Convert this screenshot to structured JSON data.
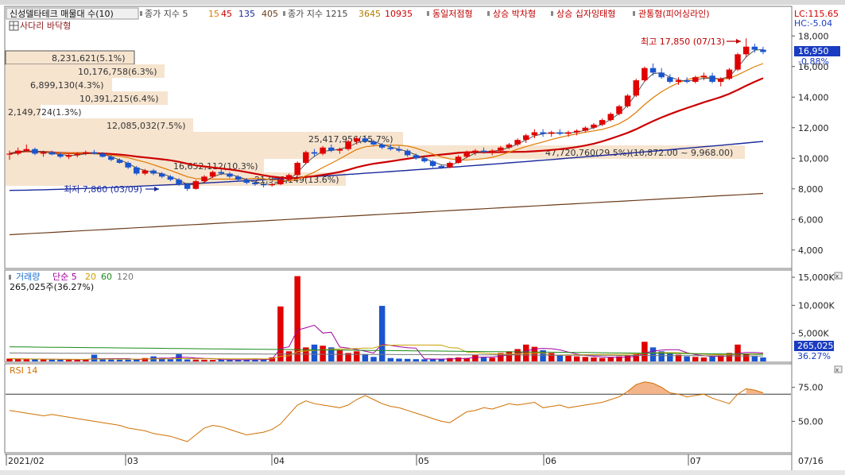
{
  "header": {
    "title_button": "신성델타테크 매물대 수(10)",
    "legend": [
      {
        "label": "종가 지수 5",
        "color": "#444444"
      },
      {
        "label": "15",
        "color": "#e07a00"
      },
      {
        "label": "45",
        "color": "#cc0000"
      },
      {
        "label": "135",
        "color": "#1a2a9c"
      },
      {
        "label": "405",
        "color": "#6b3c1a"
      },
      {
        "label": "종가 지수 1215",
        "color": "#444444"
      },
      {
        "label": "3645",
        "color": "#b07a00"
      },
      {
        "label": "10935",
        "color": "#cc0000"
      }
    ],
    "patterns": [
      {
        "label": "동일저점형",
        "color": "#c00000"
      },
      {
        "label": "상승 박차형",
        "color": "#c00000"
      },
      {
        "label": "상승 십자잉태형",
        "color": "#c00000"
      },
      {
        "label": "관통형(피어싱라인)",
        "color": "#c00000"
      }
    ],
    "pattern2": "사다리 바닥형",
    "lc": "LC:115.65",
    "hc": "HC:-5.04"
  },
  "price_panel": {
    "y_ticks": [
      "18,000",
      "16,000",
      "14,000",
      "12,000",
      "10,000",
      "8,000",
      "6,000",
      "4,000"
    ],
    "current_price": "16,950",
    "current_change": "-0.88%",
    "high_label": "최고 17,850 (07/13)",
    "low_label": "최저 7,860 (03/09)",
    "volume_profile": [
      {
        "label": "8,231,621(5.1%)"
      },
      {
        "label": "10,176,758(6.3%)"
      },
      {
        "label": "6,899,130(4.3%)"
      },
      {
        "label": "10,391,215(6.4%)"
      },
      {
        "label": "2,149,724(1.3%)"
      },
      {
        "label": "12,085,032(7.5%)"
      },
      {
        "label": "25,417,956(15.7%)"
      },
      {
        "label": "47,720,760(29.5%)(10,872.00 ~ 9,968.00)"
      },
      {
        "label": "16,652,112(10.3%)"
      },
      {
        "label": "21,958,149(13.6%)"
      }
    ]
  },
  "volume_panel": {
    "legend": [
      {
        "label": "거래량",
        "color": "#1a6fd0"
      },
      {
        "label": "단순 5",
        "color": "#a000a0"
      },
      {
        "label": "20",
        "color": "#c8a000"
      },
      {
        "label": "60",
        "color": "#1a8a1a"
      },
      {
        "label": "120",
        "color": "#777777"
      }
    ],
    "info": "265,025주(36.27%)",
    "y_ticks": [
      "15,000K",
      "10,000K",
      "5,000K"
    ],
    "current_value": "265,025",
    "current_pct": "36.27%"
  },
  "rsi_panel": {
    "label": "RSI 14",
    "y_ticks": [
      "75.00",
      "50.00"
    ]
  },
  "x_axis": {
    "labels": [
      "2021/02",
      "03",
      "04",
      "05",
      "06",
      "07"
    ],
    "end_label": "07/16"
  },
  "chart_data": {
    "type": "candlestick",
    "price_ylim": [
      3000,
      19000
    ],
    "candles": [
      [
        10250,
        10500,
        9900,
        10300
      ],
      [
        10300,
        10700,
        10200,
        10500
      ],
      [
        10500,
        10900,
        10400,
        10600
      ],
      [
        10600,
        10700,
        10200,
        10300
      ],
      [
        10300,
        10500,
        10100,
        10400
      ],
      [
        10400,
        10500,
        10200,
        10250
      ],
      [
        10250,
        10400,
        10000,
        10100
      ],
      [
        10100,
        10300,
        9950,
        10200
      ],
      [
        10200,
        10400,
        10050,
        10300
      ],
      [
        10300,
        10500,
        10200,
        10400
      ],
      [
        10400,
        10550,
        10250,
        10300
      ],
      [
        10300,
        10400,
        10050,
        10100
      ],
      [
        10100,
        10200,
        9800,
        9900
      ],
      [
        9900,
        10000,
        9650,
        9700
      ],
      [
        9700,
        9800,
        9300,
        9400
      ],
      [
        9400,
        9500,
        8900,
        9000
      ],
      [
        9000,
        9300,
        8900,
        9200
      ],
      [
        9200,
        9300,
        8900,
        9000
      ],
      [
        9000,
        9100,
        8700,
        8800
      ],
      [
        8800,
        8900,
        8500,
        8600
      ],
      [
        8600,
        8700,
        8200,
        8300
      ],
      [
        8300,
        8400,
        7860,
        8000
      ],
      [
        8000,
        8600,
        7950,
        8500
      ],
      [
        8500,
        8900,
        8400,
        8800
      ],
      [
        8800,
        9200,
        8700,
        9100
      ],
      [
        9100,
        9300,
        8900,
        9000
      ],
      [
        9000,
        9100,
        8700,
        8800
      ],
      [
        8800,
        8900,
        8500,
        8600
      ],
      [
        8600,
        8700,
        8300,
        8400
      ],
      [
        8400,
        8500,
        8200,
        8300
      ],
      [
        8300,
        8400,
        8100,
        8250
      ],
      [
        8250,
        8400,
        8150,
        8300
      ],
      [
        8300,
        8700,
        8250,
        8600
      ],
      [
        8600,
        9000,
        8500,
        8900
      ],
      [
        8900,
        9800,
        8800,
        9700
      ],
      [
        9700,
        10500,
        9600,
        10400
      ],
      [
        10400,
        10600,
        10100,
        10300
      ],
      [
        10300,
        10800,
        10200,
        10700
      ],
      [
        10700,
        10900,
        10400,
        10500
      ],
      [
        10500,
        10700,
        10300,
        10600
      ],
      [
        10600,
        11200,
        10500,
        11100
      ],
      [
        11100,
        11400,
        10900,
        11300
      ],
      [
        11300,
        11500,
        11000,
        11100
      ],
      [
        11100,
        11200,
        10800,
        10900
      ],
      [
        10900,
        11000,
        10600,
        10700
      ],
      [
        10700,
        10900,
        10500,
        10600
      ],
      [
        10600,
        10800,
        10400,
        10500
      ],
      [
        10500,
        10600,
        10100,
        10200
      ],
      [
        10200,
        10300,
        9900,
        10000
      ],
      [
        10000,
        10100,
        9700,
        9800
      ],
      [
        9800,
        9900,
        9400,
        9500
      ],
      [
        9500,
        9600,
        9300,
        9400
      ],
      [
        9400,
        9800,
        9350,
        9700
      ],
      [
        9700,
        10200,
        9650,
        10100
      ],
      [
        10100,
        10500,
        10000,
        10400
      ],
      [
        10400,
        10600,
        10200,
        10500
      ],
      [
        10500,
        10700,
        10300,
        10400
      ],
      [
        10400,
        10600,
        10200,
        10500
      ],
      [
        10500,
        10800,
        10400,
        10700
      ],
      [
        10700,
        11000,
        10600,
        10900
      ],
      [
        10900,
        11300,
        10800,
        11200
      ],
      [
        11200,
        11600,
        11000,
        11500
      ],
      [
        11500,
        11900,
        11300,
        11700
      ],
      [
        11700,
        11900,
        11400,
        11600
      ],
      [
        11600,
        11800,
        11400,
        11700
      ],
      [
        11700,
        11900,
        11500,
        11600
      ],
      [
        11600,
        11800,
        11400,
        11700
      ],
      [
        11700,
        11900,
        11500,
        11800
      ],
      [
        11800,
        12100,
        11700,
        12000
      ],
      [
        12000,
        12300,
        11900,
        12200
      ],
      [
        12200,
        12600,
        12100,
        12500
      ],
      [
        12500,
        13000,
        12400,
        12900
      ],
      [
        12900,
        13500,
        12800,
        13400
      ],
      [
        13400,
        14200,
        13300,
        14100
      ],
      [
        14100,
        15200,
        14000,
        15100
      ],
      [
        15100,
        16000,
        15000,
        15900
      ],
      [
        15900,
        16200,
        15400,
        15600
      ],
      [
        15600,
        15900,
        15200,
        15300
      ],
      [
        15300,
        15500,
        14900,
        15000
      ],
      [
        15000,
        15300,
        14800,
        15100
      ],
      [
        15100,
        15300,
        14900,
        15000
      ],
      [
        15000,
        15400,
        14900,
        15300
      ],
      [
        15300,
        15600,
        15100,
        15400
      ],
      [
        15400,
        15600,
        14900,
        15000
      ],
      [
        15000,
        15300,
        14700,
        15200
      ],
      [
        15200,
        15900,
        15100,
        15800
      ],
      [
        15800,
        16900,
        15700,
        16800
      ],
      [
        16800,
        17850,
        16600,
        17300
      ],
      [
        17300,
        17500,
        16900,
        17100
      ],
      [
        17100,
        17300,
        16800,
        16950
      ]
    ],
    "volume": [
      500,
      420,
      380,
      400,
      350,
      330,
      360,
      310,
      300,
      280,
      1200,
      350,
      330,
      310,
      320,
      400,
      600,
      900,
      650,
      400,
      1300,
      350,
      320,
      300,
      280,
      300,
      280,
      260,
      300,
      350,
      400,
      700,
      1500,
      1800,
      3600,
      2500,
      3000,
      2800,
      2500,
      2000,
      1500,
      1800,
      1300,
      800,
      700,
      600,
      500,
      450,
      400,
      380,
      360,
      450,
      600,
      700,
      600,
      1200,
      700,
      650,
      1500,
      1800,
      2200,
      3000,
      2600,
      2000,
      1500,
      1200,
      1000,
      900,
      800,
      700,
      600,
      700,
      900,
      1000,
      1300,
      3500,
      2500,
      1800,
      1400,
      1200,
      900,
      800,
      700,
      900,
      1100,
      1500,
      3000,
      1400,
      900,
      700
    ],
    "big_volume_bars": [
      {
        "index": 32,
        "value": 9800
      },
      {
        "index": 34,
        "value": 15200
      },
      {
        "index": 44,
        "value": 9900
      }
    ],
    "rsi": [
      58,
      57,
      56,
      55,
      54,
      55,
      54,
      53,
      52,
      51,
      50,
      49,
      48,
      47,
      45,
      44,
      43,
      41,
      40,
      39,
      37,
      35,
      40,
      45,
      47,
      46,
      44,
      42,
      40,
      41,
      42,
      44,
      48,
      55,
      62,
      65,
      63,
      62,
      61,
      60,
      62,
      66,
      69,
      66,
      63,
      61,
      60,
      58,
      56,
      54,
      52,
      50,
      49,
      53,
      57,
      58,
      60,
      59,
      61,
      63,
      62,
      63,
      64,
      60,
      61,
      62,
      60,
      61,
      62,
      63,
      64,
      66,
      68,
      72,
      77,
      79,
      78,
      75,
      71,
      70,
      68,
      69,
      70,
      67,
      65,
      63,
      70,
      74,
      73,
      71
    ],
    "rsi_ylim": [
      28,
      90
    ],
    "rsi_reference": 70
  }
}
